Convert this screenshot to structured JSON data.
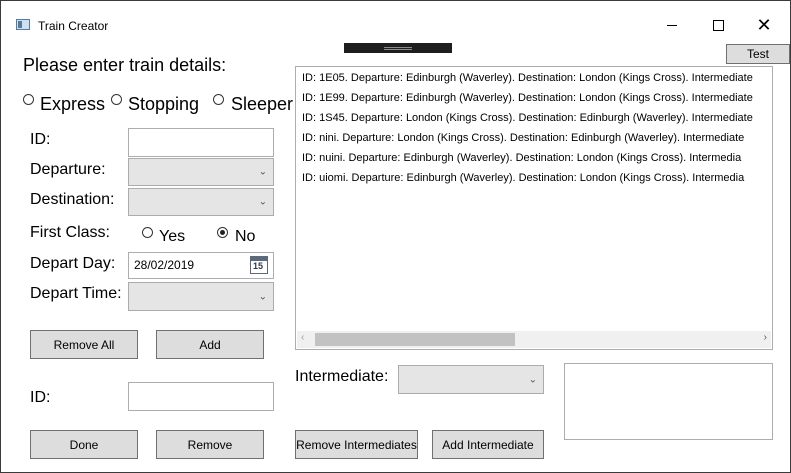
{
  "window": {
    "title": "Train Creator"
  },
  "header": {
    "prompt": "Please enter train details:"
  },
  "train_types": [
    {
      "label": "Express",
      "checked": false
    },
    {
      "label": "Stopping",
      "checked": false
    },
    {
      "label": "Sleeper",
      "checked": false
    }
  ],
  "form": {
    "id_label": "ID:",
    "id_value": "",
    "departure_label": "Departure:",
    "destination_label": "Destination:",
    "first_class_label": "First Class:",
    "first_class_yes": "Yes",
    "first_class_no": "No",
    "first_class_selected": "No",
    "depart_day_label": "Depart Day:",
    "depart_day_value": "28/02/2019",
    "calendar_day": "15",
    "depart_time_label": "Depart Time:"
  },
  "buttons": {
    "test": "Test",
    "remove_all": "Remove All",
    "add": "Add",
    "done": "Done",
    "remove": "Remove",
    "remove_intermediates": "Remove Intermediates",
    "add_intermediate": "Add Intermediate"
  },
  "bottom": {
    "id_label": "ID:",
    "id_value": ""
  },
  "intermediate": {
    "label": "Intermediate:"
  },
  "train_list": [
    "ID: 1E05. Departure: Edinburgh (Waverley). Destination: London (Kings Cross). Intermediate",
    "ID: 1E99. Departure: Edinburgh (Waverley). Destination: London (Kings Cross). Intermediate",
    "ID: 1S45. Departure: London (Kings Cross). Destination: Edinburgh (Waverley). Intermediate",
    "ID: nini. Departure: London (Kings Cross). Destination: Edinburgh (Waverley). Intermediate",
    "ID: nuini. Departure: Edinburgh (Waverley). Destination: London (Kings Cross). Intermedia",
    "ID: uiomi. Departure: Edinburgh (Waverley). Destination: London (Kings Cross). Intermedia"
  ],
  "icons": {
    "app": "window-icon",
    "calendar": "calendar-icon",
    "chevron": "chevron-down-icon"
  }
}
